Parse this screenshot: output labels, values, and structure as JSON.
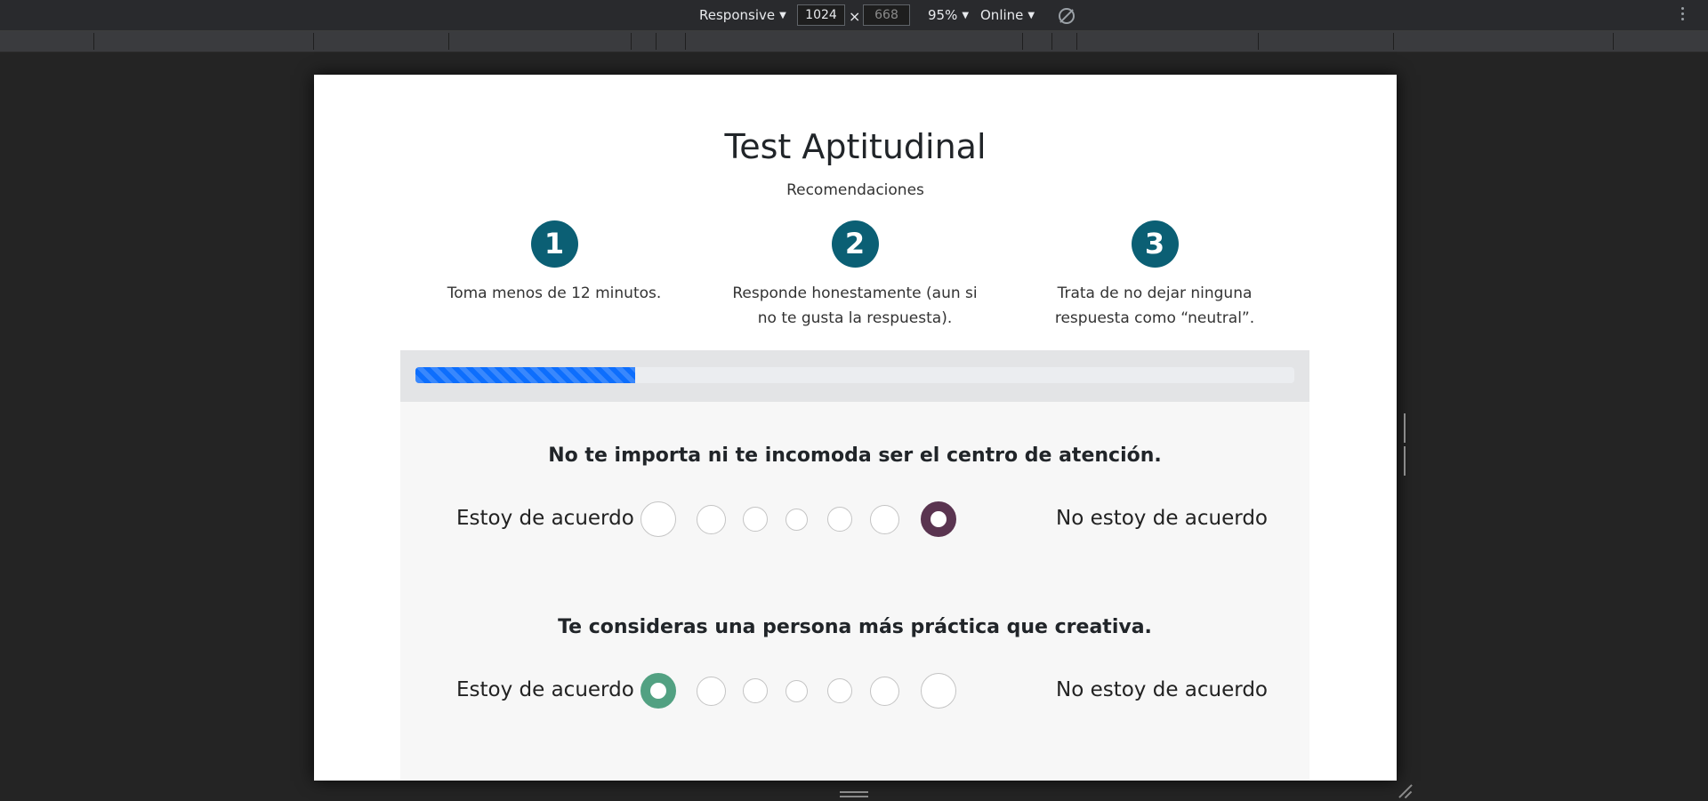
{
  "devtools": {
    "device_label": "Responsive",
    "width_value": "1024",
    "height_value": "668",
    "times_symbol": "×",
    "zoom_label": "95%",
    "throttle_label": "Online"
  },
  "page": {
    "title": "Test Aptitudinal",
    "subtitle": "Recomendaciones",
    "steps": [
      {
        "number": "1",
        "text": "Toma menos de 12 minutos."
      },
      {
        "number": "2",
        "text": "Responde honestamente (aun si no te gusta la respuesta)."
      },
      {
        "number": "3",
        "text": "Trata de no dejar ninguna respuesta como “neutral”."
      }
    ],
    "progress_fraction": 0.25,
    "colors": {
      "step_circle": "#0b5f74",
      "progress_bar": "#0d6efd",
      "selected_disagree": "#5a3450",
      "selected_agree": "#52a182"
    },
    "questions": [
      {
        "text": "No te importa ni te incomoda ser el centro de atención.",
        "left_label": "Estoy de acuerdo",
        "right_label": "No estoy de acuerdo",
        "selected_option": 7
      },
      {
        "text": "Te consideras una persona más práctica que creativa.",
        "left_label": "Estoy de acuerdo",
        "right_label": "No estoy de acuerdo",
        "selected_option": 1
      }
    ]
  }
}
